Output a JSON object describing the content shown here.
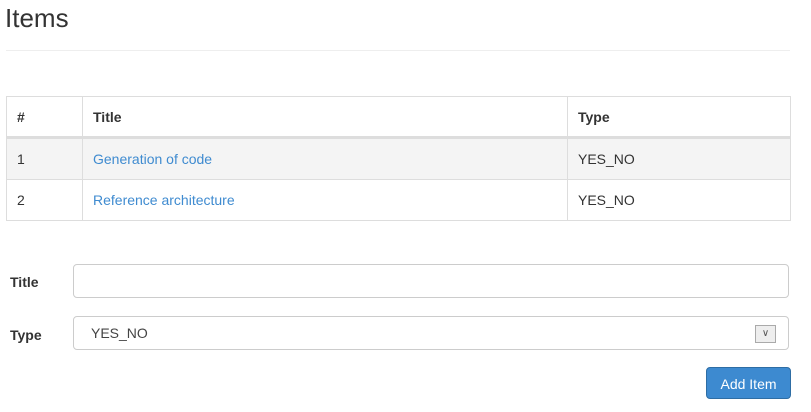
{
  "page": {
    "title": "Items"
  },
  "table": {
    "headers": [
      "#",
      "Title",
      "Type"
    ],
    "rows": [
      {
        "id": "1",
        "title": "Generation of code",
        "type": "YES_NO"
      },
      {
        "id": "2",
        "title": "Reference architecture",
        "type": "YES_NO"
      }
    ]
  },
  "form": {
    "title_label": "Title",
    "title_value": "",
    "type_label": "Type",
    "type_value": "YES_NO",
    "submit_label": "Add Item"
  },
  "colors": {
    "link": "#3f8bd0",
    "primary": "#3d8ad0"
  }
}
